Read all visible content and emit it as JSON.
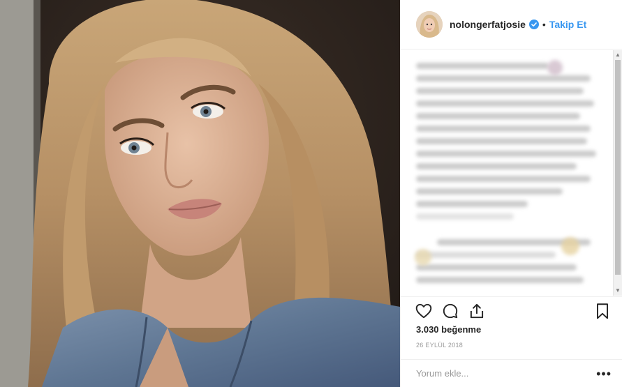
{
  "post": {
    "username": "nolongerfatjosie",
    "verified_icon": "verified-badge-icon",
    "separator": "•",
    "follow_label": "Takip Et",
    "likes": "3.030 beğenme",
    "date": "26 EYLÜL 2018",
    "comment_placeholder": "Yorum ekle...",
    "more_label": "•••"
  },
  "icons": {
    "like": "heart-icon",
    "comment": "comment-icon",
    "share": "share-icon",
    "save": "bookmark-icon"
  },
  "colors": {
    "accent": "#3897f0",
    "text": "#262626",
    "muted": "#999999",
    "border": "#efefef"
  }
}
